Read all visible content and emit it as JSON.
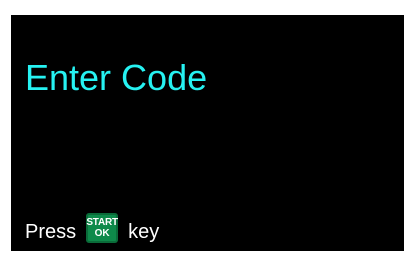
{
  "screen": {
    "title": "Enter Code",
    "prompt_before": "Press",
    "prompt_after": "key",
    "key_top": "START",
    "key_bottom": "OK"
  },
  "colors": {
    "background": "#000000",
    "title": "#26f2f2",
    "text": "#ffffff",
    "key_fill": "#0e8a4a",
    "key_text": "#ffffff"
  }
}
